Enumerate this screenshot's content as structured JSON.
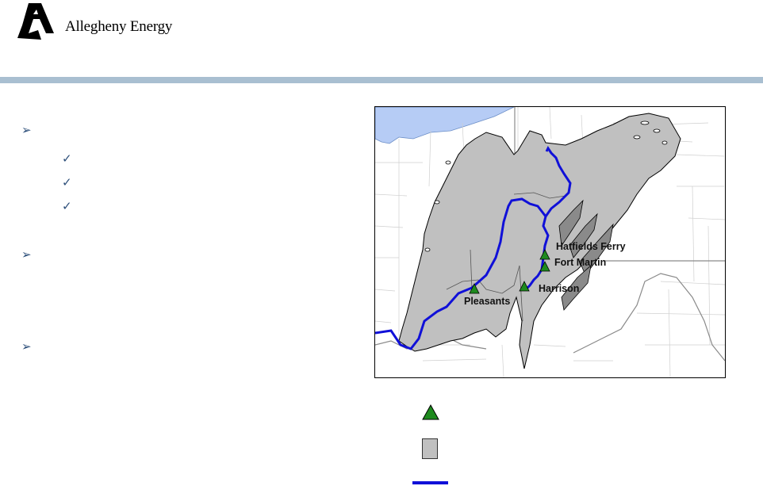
{
  "logo": {
    "company_name": "Allegheny Energy",
    "mark_icon": "allegheny-a-logo-icon"
  },
  "bullets": [
    {
      "icon": "arrow-bullet-icon"
    },
    {
      "icon": "arrow-bullet-icon"
    },
    {
      "icon": "arrow-bullet-icon"
    }
  ],
  "checks": [
    {
      "icon": "checkmark-icon"
    },
    {
      "icon": "checkmark-icon"
    },
    {
      "icon": "checkmark-icon"
    }
  ],
  "map": {
    "plants": [
      {
        "label": "Hatfields Ferry"
      },
      {
        "label": "Fort Martin"
      },
      {
        "label": "Harrison"
      },
      {
        "label": "Pleasants"
      }
    ],
    "colors": {
      "lake": "#b6ccf5",
      "coal_region": "#c0c0c0",
      "pipeline": "#1010d8",
      "plant_marker": "#1e8a1e",
      "county_lines": "#c8c8c8",
      "state_lines": "#909090"
    }
  },
  "legend": {
    "items": [
      {
        "icon": "green-triangle-icon"
      },
      {
        "icon": "gray-square-icon"
      },
      {
        "icon": "blue-line-icon"
      }
    ]
  }
}
